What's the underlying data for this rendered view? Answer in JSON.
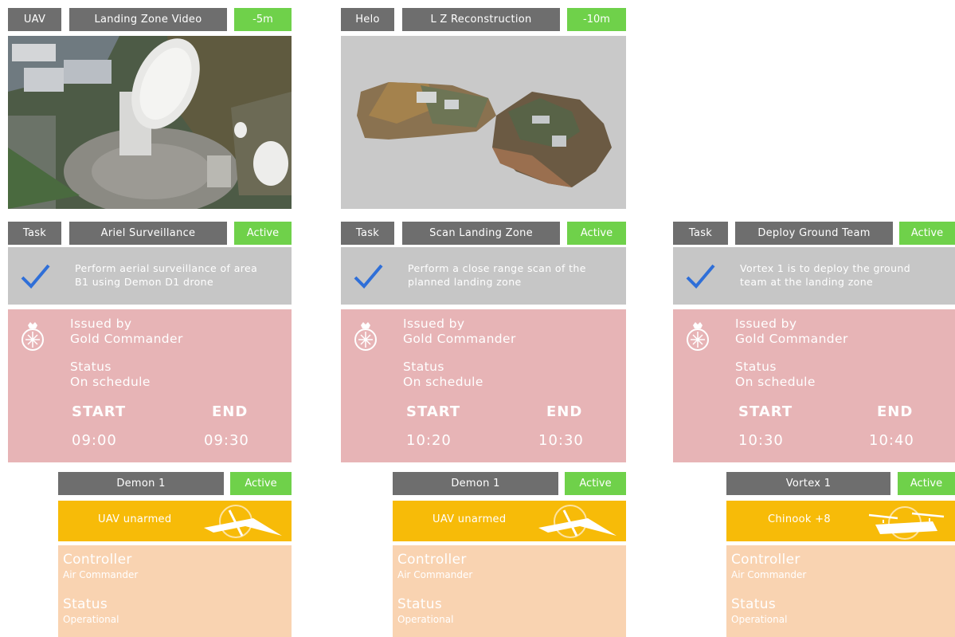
{
  "top_panels": [
    {
      "source": "UAV",
      "title": "Landing Zone Video",
      "age": "-5m"
    },
    {
      "source": "Helo",
      "title": "L Z Reconstruction",
      "age": "-10m"
    }
  ],
  "tasks": [
    {
      "task_label": "Task",
      "name": "Ariel Surveillance",
      "status": "Active",
      "description": "Perform aerial surveillance of area B1 using Demon D1 drone",
      "issued_label": "Issued by",
      "issued_value": "Gold Commander",
      "status_label": "Status",
      "status_value": "On schedule",
      "start_label": "START",
      "end_label": "END",
      "start": "09:00",
      "end": "09:30",
      "asset": {
        "name": "Demon 1",
        "status": "Active",
        "type": "UAV unarmed",
        "controller_label": "Controller",
        "controller": "Air Commander",
        "status_label": "Status",
        "status_value": "Operational"
      }
    },
    {
      "task_label": "Task",
      "name": "Scan Landing Zone",
      "status": "Active",
      "description": "Perform a close range scan of the planned landing zone",
      "issued_label": "Issued by",
      "issued_value": "Gold Commander",
      "status_label": "Status",
      "status_value": "On schedule",
      "start_label": "START",
      "end_label": "END",
      "start": "10:20",
      "end": "10:30",
      "asset": {
        "name": "Demon 1",
        "status": "Active",
        "type": "UAV unarmed",
        "controller_label": "Controller",
        "controller": "Air Commander",
        "status_label": "Status",
        "status_value": "Operational"
      }
    },
    {
      "task_label": "Task",
      "name": "Deploy Ground Team",
      "status": "Active",
      "description": "Vortex 1 is to deploy the ground team at the landing zone",
      "issued_label": "Issued by",
      "issued_value": "Gold Commander",
      "status_label": "Status",
      "status_value": "On schedule",
      "start_label": "START",
      "end_label": "END",
      "start": "10:30",
      "end": "10:40",
      "asset": {
        "name": "Vortex 1",
        "status": "Active",
        "type": "Chinook +8",
        "controller_label": "Controller",
        "controller": "Air Commander",
        "status_label": "Status",
        "status_value": "Operational"
      }
    }
  ],
  "colors": {
    "header_gray": "#6e6e6e",
    "active_green": "#6fd14a",
    "panel_gray": "#c6c6c6",
    "task_pink": "#e7b4b6",
    "asset_yellow": "#f7bb08",
    "asset_peach": "#f9d3b1",
    "check_blue": "#2f6fd8"
  },
  "icons": {
    "check": "checkmark-icon",
    "emblem": "crest-emblem-icon",
    "uav": "drone-silhouette-icon",
    "helicopter": "chinook-silhouette-icon"
  }
}
